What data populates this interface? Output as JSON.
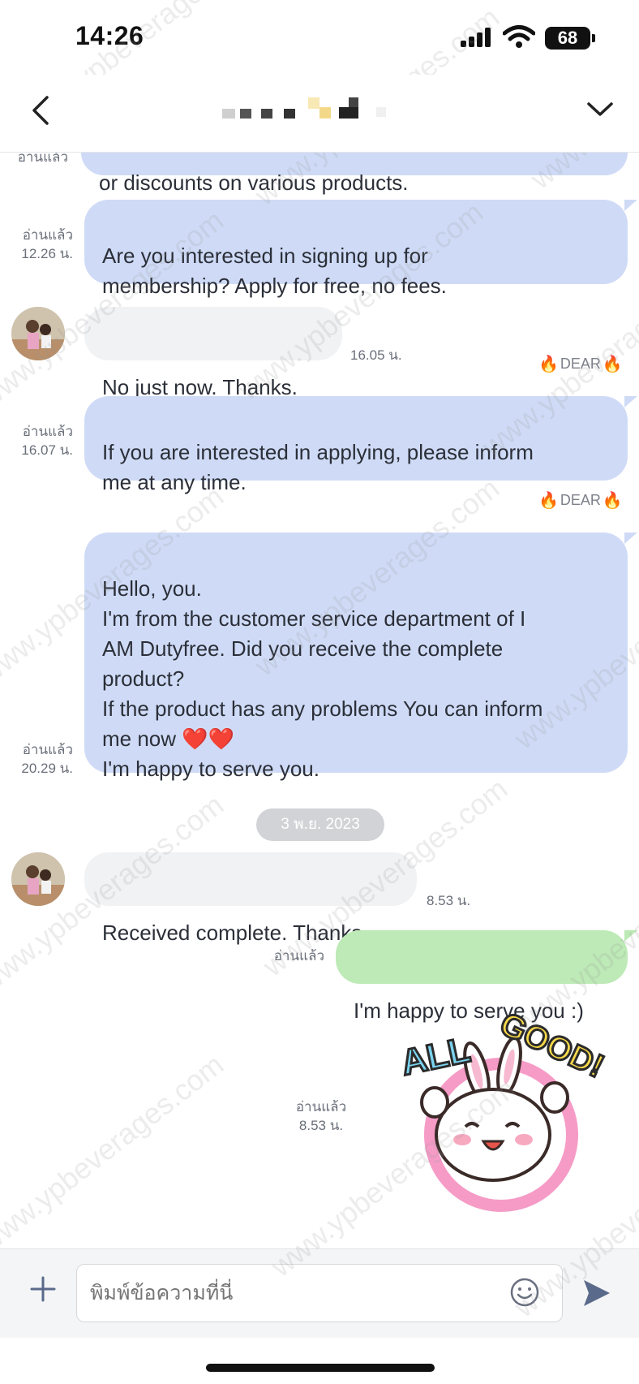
{
  "status_bar": {
    "time": "14:26",
    "battery": "68"
  },
  "colors": {
    "sent_blue": "#cfdbf6",
    "received_gray": "#f1f2f4",
    "sent_green": "#bdeab6",
    "fire": "#f05a14",
    "send_accent": "#5a6a8a"
  },
  "icons": {
    "back": "chevron-left-icon",
    "dropdown": "chevron-down-icon",
    "plus": "plus-icon",
    "emoji": "smiley-icon",
    "send": "send-arrow-icon"
  },
  "messages": [
    {
      "id": "m1",
      "type": "sent",
      "text": "or discounts on various products.",
      "read": "อ่านแล้ว"
    },
    {
      "id": "m2",
      "type": "sent",
      "text": "Are you interested in signing up for\nmembership? Apply for free, no fees.",
      "read": "อ่านแล้ว",
      "time": "12.26 น."
    },
    {
      "id": "m3",
      "type": "received",
      "text": "No just now. Thanks.",
      "time": "16.05 น."
    },
    {
      "id": "m4",
      "type": "sent",
      "sender": "DEAR",
      "text": "If you are interested in applying, please inform\nme at any time.",
      "read": "อ่านแล้ว",
      "time": "16.07 น."
    },
    {
      "id": "m5",
      "type": "sent",
      "sender": "DEAR",
      "text": "Hello, you.\nI'm from the customer service department of I\nAM Dutyfree. Did you receive the complete\nproduct?\nIf the product has any problems You can inform\nme now ❤️❤️\nI'm happy to serve you.",
      "read": "อ่านแล้ว",
      "time": "20.29 น."
    },
    {
      "id": "m6",
      "type": "received",
      "text": "Received complete. Thanks.",
      "time": "8.53 น."
    },
    {
      "id": "m7",
      "type": "sent",
      "text": "I'm happy to serve you :)",
      "read": "อ่านแล้ว"
    },
    {
      "id": "m8",
      "type": "sticker",
      "sticker_text": "ALL GOOD!",
      "read": "อ่านแล้ว",
      "time": "8.53 น."
    }
  ],
  "date_separator": "3 พ.ย. 2023",
  "input": {
    "placeholder": "พิมพ์ข้อความที่นี่"
  },
  "watermark": "www.ypbeverages.com"
}
